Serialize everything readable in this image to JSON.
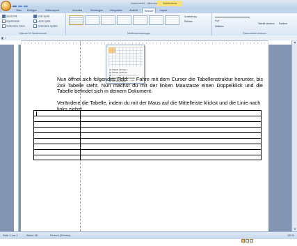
{
  "window": {
    "title": "Dokument1 - Microsoft Word",
    "context_tab": "Tabellentools"
  },
  "tabs": [
    {
      "label": "Start"
    },
    {
      "label": "Einfügen"
    },
    {
      "label": "Seitenlayout"
    },
    {
      "label": "Verweise"
    },
    {
      "label": "Sendungen"
    },
    {
      "label": "Überprüfen"
    },
    {
      "label": "Ansicht"
    },
    {
      "label": "Entwurf"
    },
    {
      "label": "Layout"
    }
  ],
  "ribbon": {
    "options": {
      "items": [
        {
          "label": "Überschrift",
          "checked": true
        },
        {
          "label": "Erste Spalte",
          "checked": true
        },
        {
          "label": "Ergebniszeile",
          "checked": false
        },
        {
          "label": "Letzte Spalte",
          "checked": false
        },
        {
          "label": "Verbundene Zeilen",
          "checked": false
        },
        {
          "label": "Verbundene Spalten",
          "checked": false
        }
      ],
      "group_label": "Optionen für Tabellenformat"
    },
    "styles_group_label": "Tabellenformatvorlagen",
    "shading_label": "Schattierung",
    "borders_label": "Rahmen",
    "pen_size": "½ pt",
    "pen_color_label": "Stiftfarbe",
    "draw_table_label": "Tabelle zeichnen",
    "eraser_label": "Radierer",
    "draw_group_label": "Rahmenlinien zeichnen"
  },
  "insert_table_menu": {
    "items": [
      {
        "label": "Tabelle einfügen...",
        "disabled": false
      },
      {
        "label": "Tabelle zeichnen",
        "disabled": false
      },
      {
        "label": "Text in Tabelle umwandeln...",
        "disabled": true
      },
      {
        "label": "Excel-Kalkulationstabelle",
        "disabled": false
      },
      {
        "label": "Schnelltabellen",
        "disabled": false
      }
    ]
  },
  "document": {
    "paragraph1": "Nun öffnet sich folgendes Feld: ... Fahre mit dem Curser die Tabellenstruktur herunter, bis 2x8 Tabelle steht. Nun machst du mit der linken Maustaste einen Doppelklick und die Tabelle befindet sich in deinem Dokument.",
    "paragraph2": "Verändere die Tabelle, indem du mit der Maus auf die Mittelleiste klickst und die Linie nach links ziehst."
  },
  "status": {
    "page": "Seite: 1 von 1",
    "words": "Wörter: 80",
    "language": "Deutsch (Schweiz)",
    "zoom": "100 %"
  },
  "colors": {
    "accent": "#3f6bb0",
    "context_tab": "#f7e37a",
    "selection": "#f4c26c"
  }
}
